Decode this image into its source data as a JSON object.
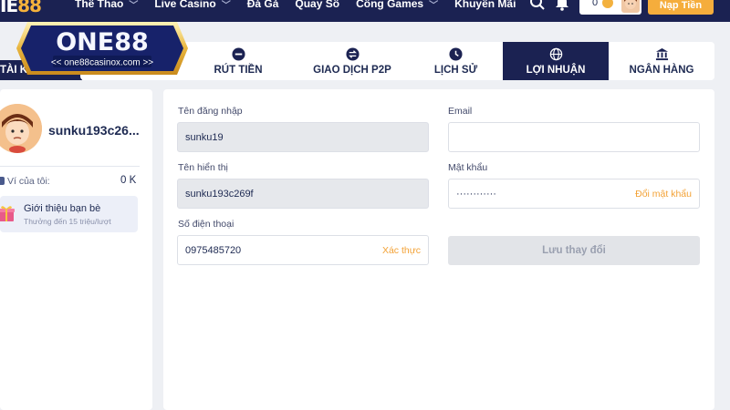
{
  "nav": {
    "brand_main": "IE",
    "brand_num": "88",
    "links": [
      {
        "label": "Thể Thao",
        "has_chevron": true
      },
      {
        "label": "Live Casino",
        "has_chevron": true
      },
      {
        "label": "Đá Gà",
        "has_chevron": false
      },
      {
        "label": "Quay Số",
        "has_chevron": false
      },
      {
        "label": "Cổng Games",
        "has_chevron": true
      },
      {
        "label": "Khuyến Mãi",
        "has_chevron": false
      }
    ],
    "balance": "0",
    "deposit_label": "Nạp Tiền"
  },
  "logo": {
    "name": "ONE88",
    "url_text": "<< one88casinox.com >>"
  },
  "account_tab_label": "TÀI KH",
  "tabs": [
    {
      "label": "RÚT TIỀN",
      "icon": "minus-circle-icon",
      "active": false
    },
    {
      "label": "GIAO DỊCH P2P",
      "icon": "transfer-icon",
      "active": false
    },
    {
      "label": "LỊCH SỬ",
      "icon": "clock-icon",
      "active": false
    },
    {
      "label": "LỢI NHUẬN",
      "icon": "globe-icon",
      "active": true
    },
    {
      "label": "NGÂN HÀNG",
      "icon": "bank-icon",
      "active": false
    }
  ],
  "sidebar": {
    "username": "sunku193c26...",
    "wallet_label": "Ví của tôi:",
    "wallet_value": "0 K",
    "referral_title": "Giới thiệu bạn bè",
    "referral_sub": "Thưởng đến 15 triệu/lượt"
  },
  "form": {
    "username_label": "Tên đăng nhập",
    "username_value": "sunku19",
    "email_label": "Email",
    "email_value": "",
    "display_label": "Tên hiển thị",
    "display_value": "sunku193c269f",
    "password_label": "Mật khẩu",
    "password_value": "············",
    "password_action": "Đổi mật khẩu",
    "phone_label": "Số điện thoại",
    "phone_value": "0975485720",
    "phone_action": "Xác thực",
    "save_label": "Lưu thay đổi"
  },
  "colors": {
    "navy": "#1b2252",
    "accent": "#f5ad3c"
  }
}
